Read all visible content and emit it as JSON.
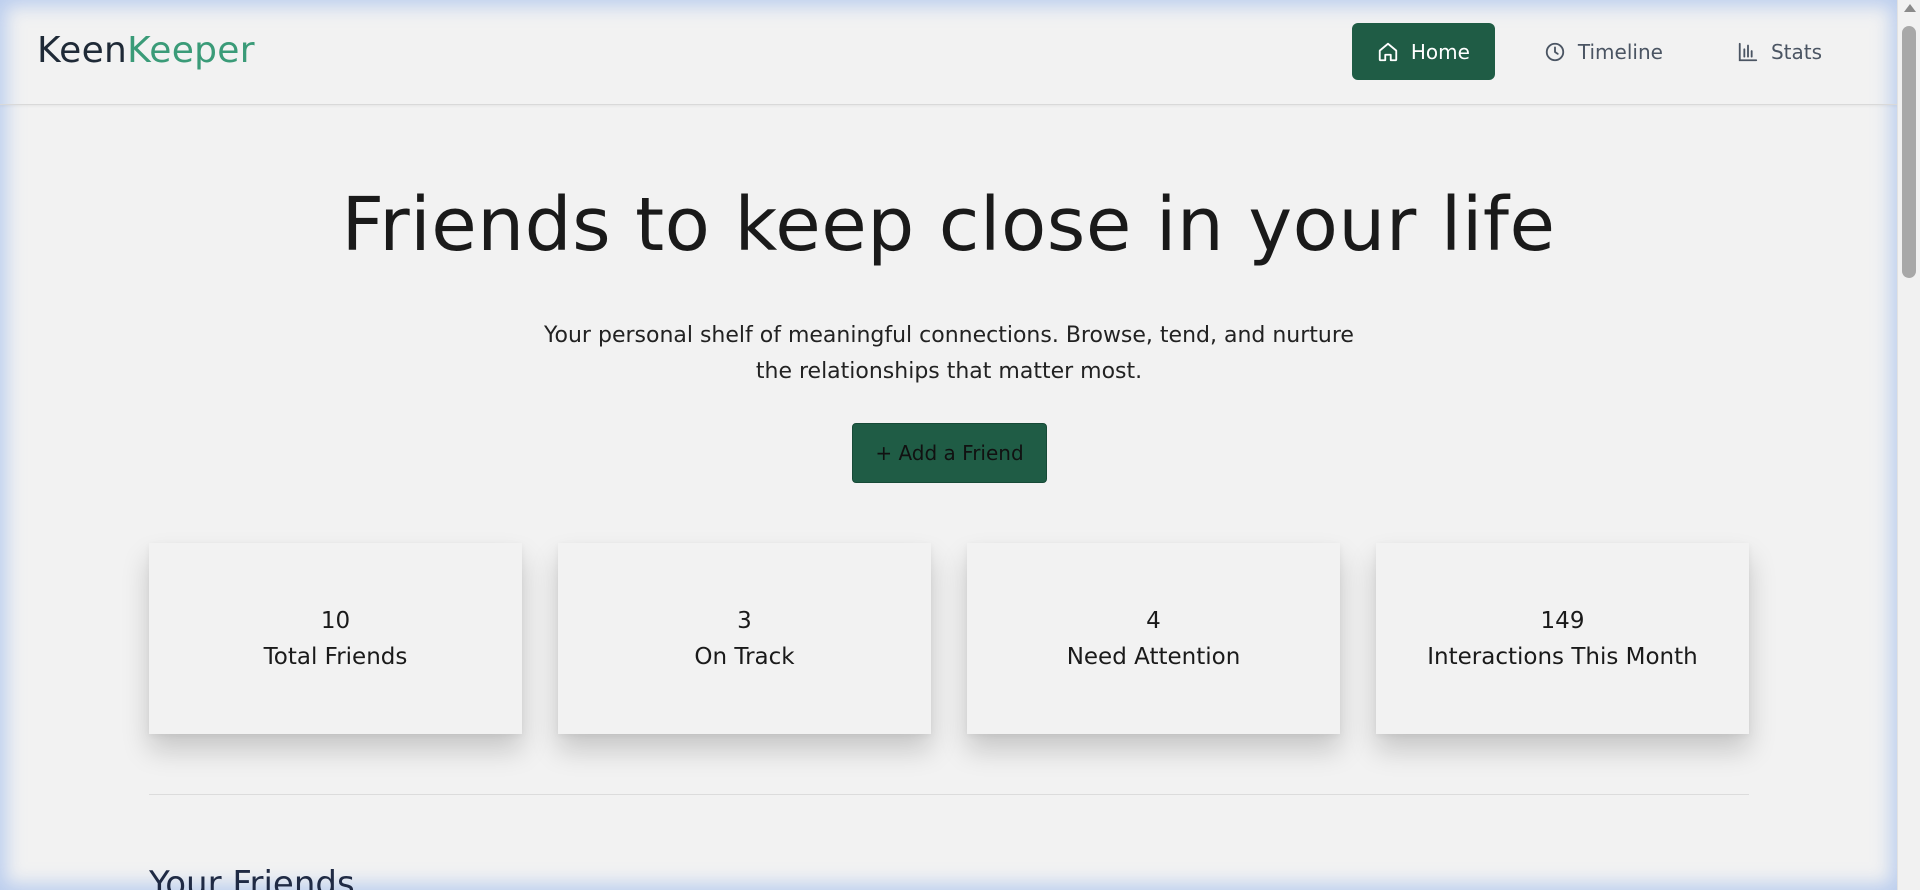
{
  "brand": {
    "part1": "Keen",
    "part2": "Keeper"
  },
  "nav": {
    "home": "Home",
    "timeline": "Timeline",
    "stats": "Stats"
  },
  "icons": {
    "home": "home-icon",
    "timeline": "clock-icon",
    "stats": "bar-chart-icon"
  },
  "colors": {
    "accent": "#1f5c45",
    "brand_accent": "#3a9b78"
  },
  "hero": {
    "title": "Friends to keep close in your life",
    "subtitle": "Your personal shelf of meaningful connections. Browse, tend, and nurture the relationships that matter most.",
    "add_button": "+ Add a Friend"
  },
  "stats": [
    {
      "value": "10",
      "label": "Total Friends"
    },
    {
      "value": "3",
      "label": "On Track"
    },
    {
      "value": "4",
      "label": "Need Attention"
    },
    {
      "value": "149",
      "label": "Interactions This Month"
    }
  ],
  "friends_section": {
    "title": "Your Friends"
  }
}
